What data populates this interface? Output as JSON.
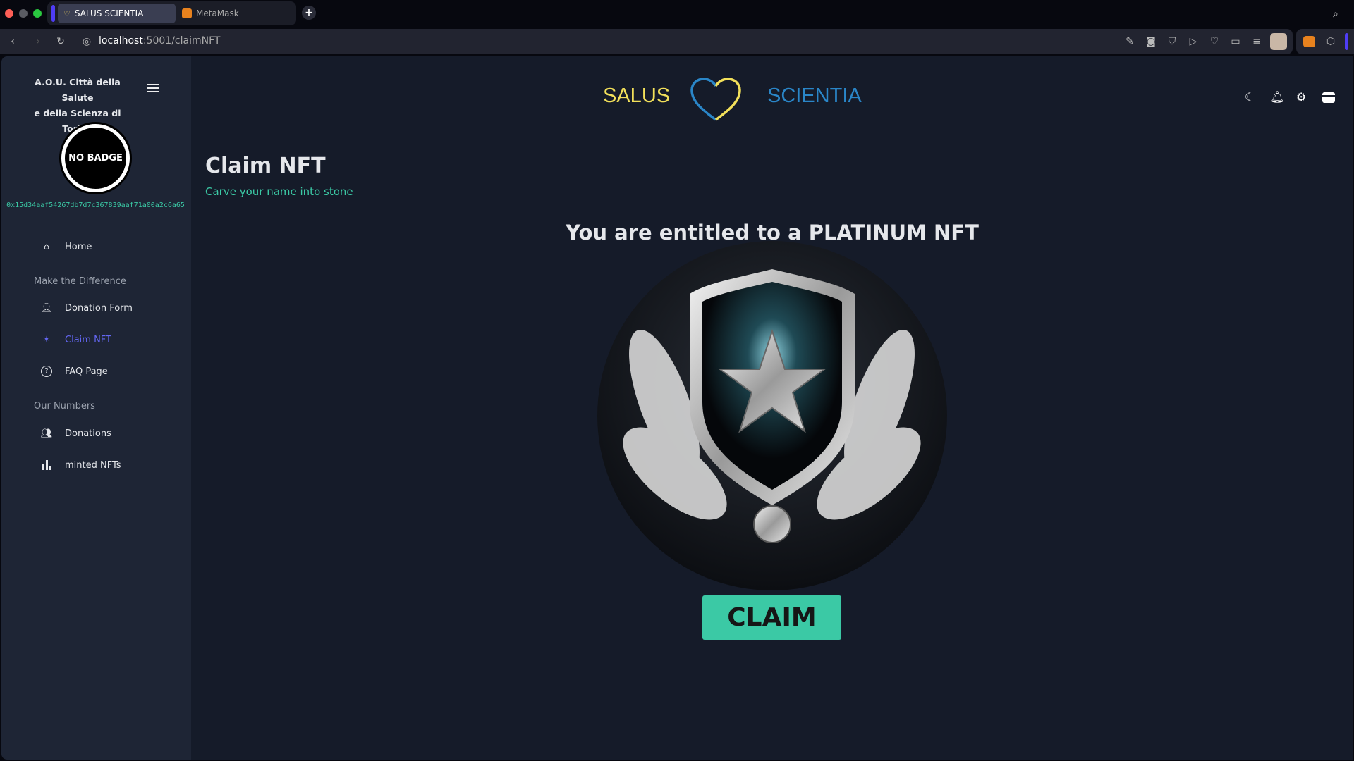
{
  "browser": {
    "tabs": [
      {
        "label": "SALUS SCIENTIA",
        "active": true
      },
      {
        "label": "MetaMask",
        "active": false
      }
    ],
    "url_host": "localhost",
    "url_path": ":5001/claimNFT",
    "new_tab": "+"
  },
  "sidebar": {
    "org_line1": "A.O.U. Città della Salute",
    "org_line2": "e della Scienza di Torino",
    "badge": "NO BADGE",
    "wallet": "0x15d34aaf54267db7d7c367839aaf71a00a2c6a65",
    "home": "Home",
    "section1": "Make the Difference",
    "donation_form": "Donation Form",
    "claim_nft": "Claim NFT",
    "faq": "FAQ Page",
    "section2": "Our Numbers",
    "donations": "Donations",
    "minted": "minted NFTs"
  },
  "header": {
    "left": "SALUS",
    "right": "SCIENTIA"
  },
  "page": {
    "title": "Claim NFT",
    "subtitle": "Carve your name into stone",
    "entitled": "You are entitled to a PLATINUM NFT",
    "claim": "CLAIM"
  },
  "colors": {
    "accent": "#3bc9a5",
    "yellow": "#f2e05a",
    "blue": "#2a86c8",
    "active": "#6366f1"
  }
}
